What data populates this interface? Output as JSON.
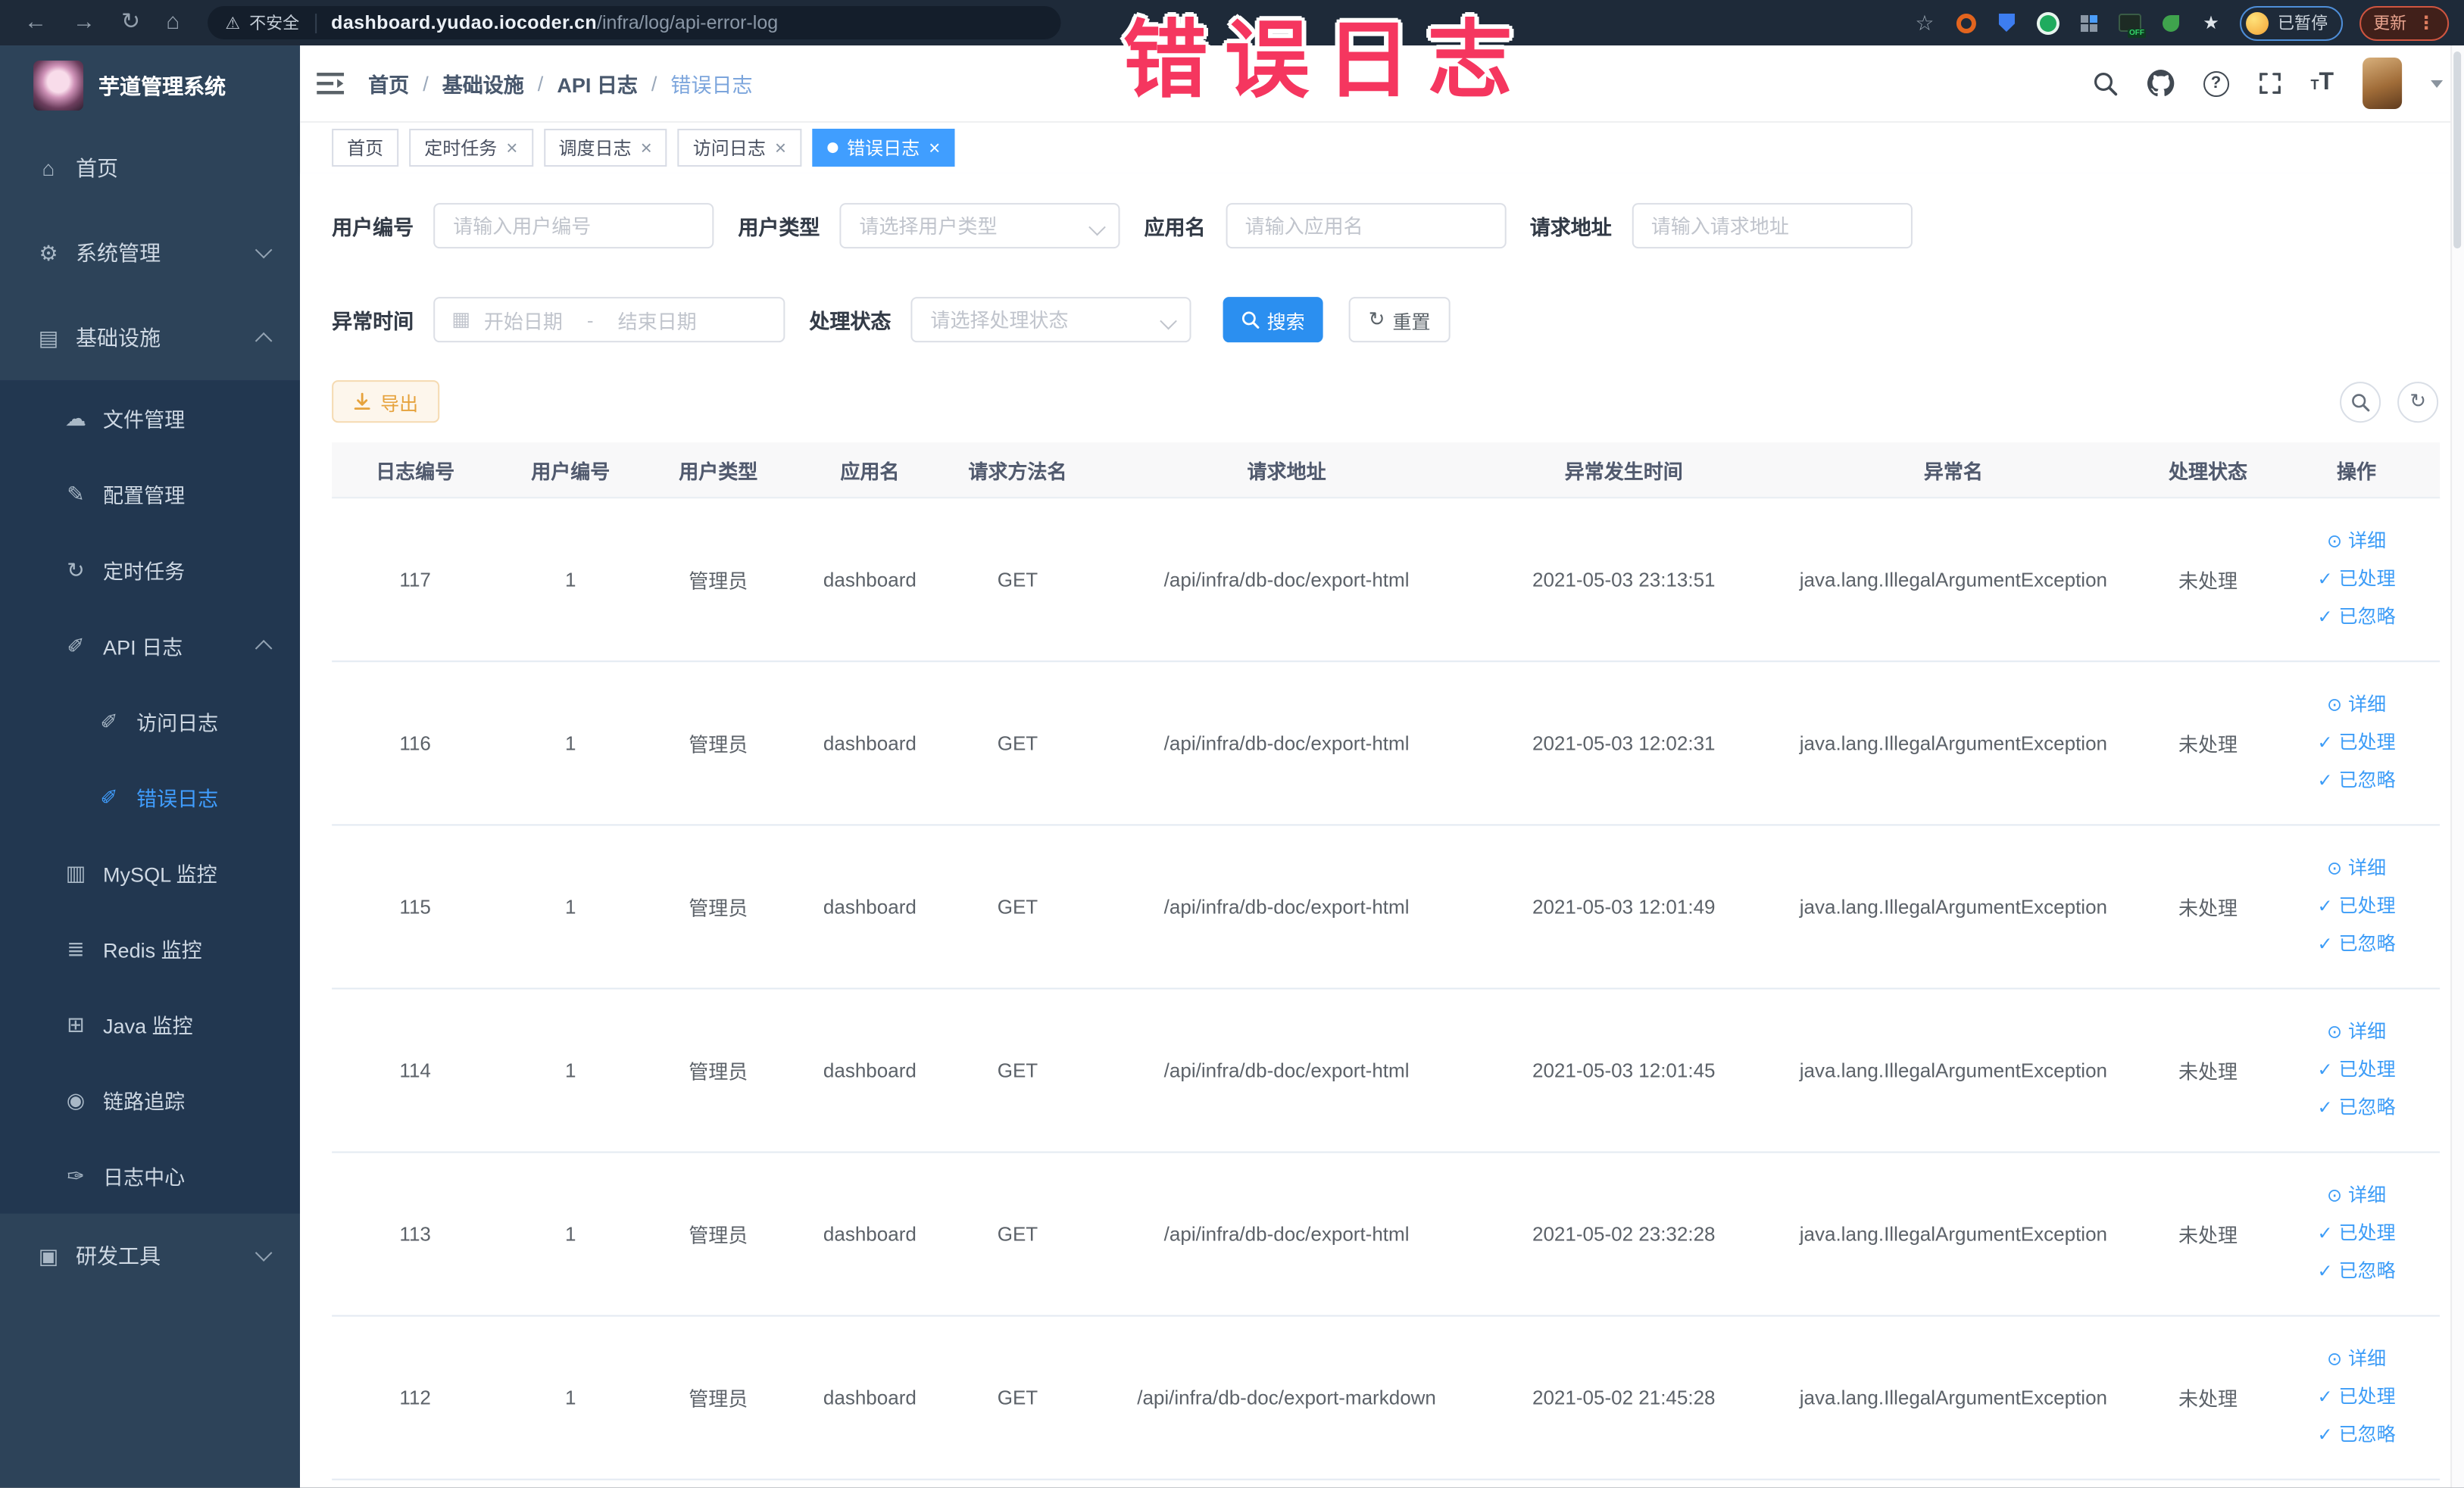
{
  "annotation": {
    "text": "错误日志",
    "color": "#f5365f"
  },
  "browser": {
    "nav_icons": [
      "back-arrow",
      "forward-arrow",
      "reload",
      "home"
    ],
    "security_label": "不安全",
    "url_host": "dashboard.yudao.iocoder.cn",
    "url_path": "/infra/log/api-error-log",
    "extensions": [
      "bookmark-star",
      "orange-ring-extension",
      "blue-shield-extension",
      "green-badge-extension",
      "grid-extension",
      "switch-off-extension",
      "green-leaf-extension",
      "white-star-extension"
    ],
    "paused_label": "已暂停",
    "update_label": "更新"
  },
  "sidebar": {
    "title": "芋道管理系统",
    "items": [
      {
        "label": "首页",
        "icon": "home",
        "level": 0
      },
      {
        "label": "系统管理",
        "icon": "gear",
        "level": 0,
        "chevron": "down"
      },
      {
        "label": "基础设施",
        "icon": "monitor",
        "level": 0,
        "chevron": "up"
      },
      {
        "label": "文件管理",
        "icon": "cloud",
        "level": 1,
        "sub": true
      },
      {
        "label": "配置管理",
        "icon": "edit",
        "level": 1,
        "sub": true
      },
      {
        "label": "定时任务",
        "icon": "timer",
        "level": 1,
        "sub": true
      },
      {
        "label": "API 日志",
        "icon": "log",
        "level": 1,
        "sub": true,
        "chevron": "up"
      },
      {
        "label": "访问日志",
        "icon": "doc-edit",
        "level": 2,
        "sub": true
      },
      {
        "label": "错误日志",
        "icon": "doc-edit",
        "level": 2,
        "sub": true,
        "active": true
      },
      {
        "label": "MySQL 监控",
        "icon": "mysql",
        "level": 1,
        "sub": true
      },
      {
        "label": "Redis 监控",
        "icon": "redis",
        "level": 1,
        "sub": true
      },
      {
        "label": "Java 监控",
        "icon": "java",
        "level": 1,
        "sub": true
      },
      {
        "label": "链路追踪",
        "icon": "trace",
        "level": 1,
        "sub": true
      },
      {
        "label": "日志中心",
        "icon": "log-center",
        "level": 1,
        "sub": true
      },
      {
        "label": "研发工具",
        "icon": "tools",
        "level": 0,
        "chevron": "down"
      }
    ]
  },
  "navbar": {
    "breadcrumb": [
      {
        "label": "首页"
      },
      {
        "label": "基础设施"
      },
      {
        "label": "API 日志"
      },
      {
        "label": "错误日志",
        "current": true
      }
    ],
    "icons": [
      "search",
      "github",
      "help",
      "fullscreen",
      "text-size"
    ]
  },
  "tabs": [
    {
      "label": "首页"
    },
    {
      "label": "定时任务",
      "closable": true
    },
    {
      "label": "调度日志",
      "closable": true
    },
    {
      "label": "访问日志",
      "closable": true
    },
    {
      "label": "错误日志",
      "closable": true,
      "active": true
    }
  ],
  "filters": {
    "fields": [
      {
        "label": "用户编号",
        "type": "input",
        "placeholder": "请输入用户编号"
      },
      {
        "label": "用户类型",
        "type": "select",
        "placeholder": "请选择用户类型"
      },
      {
        "label": "应用名",
        "type": "input",
        "placeholder": "请输入应用名"
      },
      {
        "label": "请求地址",
        "type": "input",
        "placeholder": "请输入请求地址"
      }
    ],
    "time_label": "异常时间",
    "date_start_placeholder": "开始日期",
    "date_range_separator": "-",
    "date_end_placeholder": "结束日期",
    "status_label": "处理状态",
    "status_placeholder": "请选择处理状态",
    "search_label": "搜索",
    "reset_label": "重置"
  },
  "toolbar": {
    "export_label": "导出"
  },
  "table": {
    "columns": [
      "日志编号",
      "用户编号",
      "用户类型",
      "应用名",
      "请求方法名",
      "请求地址",
      "异常发生时间",
      "异常名",
      "处理状态",
      "操作"
    ],
    "actions": [
      {
        "label": "详细",
        "icon": "eye"
      },
      {
        "label": "已处理",
        "icon": "check"
      },
      {
        "label": "已忽略",
        "icon": "check"
      }
    ],
    "rows": [
      {
        "log_id": "117",
        "user_id": "1",
        "user_type": "管理员",
        "app_name": "dashboard",
        "method": "GET",
        "url": "/api/infra/db-doc/export-html",
        "time": "2021-05-03 23:13:51",
        "exception": "java.lang.IllegalArgumentException",
        "status": "未处理"
      },
      {
        "log_id": "116",
        "user_id": "1",
        "user_type": "管理员",
        "app_name": "dashboard",
        "method": "GET",
        "url": "/api/infra/db-doc/export-html",
        "time": "2021-05-03 12:02:31",
        "exception": "java.lang.IllegalArgumentException",
        "status": "未处理"
      },
      {
        "log_id": "115",
        "user_id": "1",
        "user_type": "管理员",
        "app_name": "dashboard",
        "method": "GET",
        "url": "/api/infra/db-doc/export-html",
        "time": "2021-05-03 12:01:49",
        "exception": "java.lang.IllegalArgumentException",
        "status": "未处理"
      },
      {
        "log_id": "114",
        "user_id": "1",
        "user_type": "管理员",
        "app_name": "dashboard",
        "method": "GET",
        "url": "/api/infra/db-doc/export-html",
        "time": "2021-05-03 12:01:45",
        "exception": "java.lang.IllegalArgumentException",
        "status": "未处理"
      },
      {
        "log_id": "113",
        "user_id": "1",
        "user_type": "管理员",
        "app_name": "dashboard",
        "method": "GET",
        "url": "/api/infra/db-doc/export-html",
        "time": "2021-05-02 23:32:28",
        "exception": "java.lang.IllegalArgumentException",
        "status": "未处理"
      },
      {
        "log_id": "112",
        "user_id": "1",
        "user_type": "管理员",
        "app_name": "dashboard",
        "method": "GET",
        "url": "/api/infra/db-doc/export-markdown",
        "time": "2021-05-02 21:45:28",
        "exception": "java.lang.IllegalArgumentException",
        "status": "未处理"
      }
    ]
  },
  "colors": {
    "primary": "#409eff",
    "active_tab": "#409eff",
    "annotation": "#f5365f",
    "warning_button": "#e6a23c",
    "sidebar_bg": "#2d4359",
    "submenu_bg": "#223750",
    "chrome_bg": "#1e2a39"
  }
}
